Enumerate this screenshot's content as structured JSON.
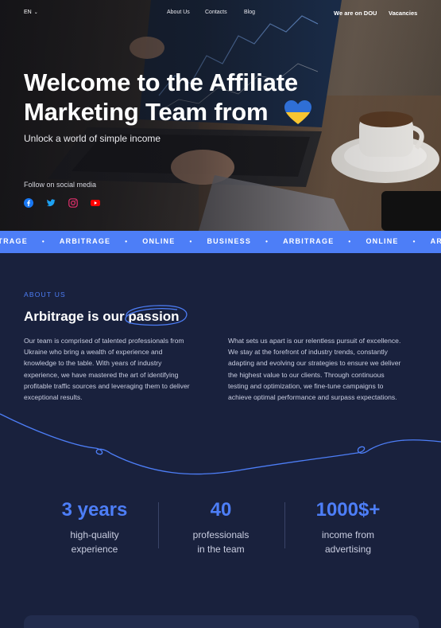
{
  "nav": {
    "lang": "EN",
    "links": [
      "About Us",
      "Contacts",
      "Blog"
    ],
    "dou": "We are on DOU",
    "vacancies": "Vacancies"
  },
  "hero": {
    "title_line1": "Welcome to the Affiliate",
    "title_line2": "Marketing Team from",
    "subtitle": "Unlock a world of simple income",
    "follow": "Follow on social media",
    "socials": [
      "facebook-icon",
      "twitter-icon",
      "instagram-icon",
      "youtube-icon"
    ],
    "flag_colors": {
      "top": "#2f6fd6",
      "bottom": "#f7c531"
    }
  },
  "ticker": {
    "items": [
      "BITRAGE",
      "ARBITRAGE",
      "ONLINE",
      "BUSINESS",
      "ARBITRAGE",
      "ONLINE",
      "ARBITR"
    ],
    "color": "#4d7ef7"
  },
  "about": {
    "eyebrow": "ABOUT US",
    "title_prefix": "Arbitrage is our",
    "title_highlight": "passion",
    "left_text": "Our team is comprised of talented professionals from Ukraine who bring a wealth of experience and knowledge to the table. With years of industry experience, we have mastered the art of identifying profitable traffic sources and leveraging them to deliver exceptional results.",
    "right_text": "What sets us apart is our relentless pursuit of excellence. We stay at the forefront of industry trends, constantly adapting and evolving our strategies to ensure we deliver the highest value to our clients. Through continuous testing and optimization, we fine-tune campaigns to achieve optimal performance and surpass expectations."
  },
  "stats": [
    {
      "num": "3 years",
      "line1": "high-quality",
      "line2": "experience"
    },
    {
      "num": "40",
      "line1": "professionals",
      "line2": "in the team"
    },
    {
      "num": "1000$+",
      "line1": "income from",
      "line2": "advertising"
    }
  ],
  "colors": {
    "accent": "#4d7ef7",
    "background": "#19213d"
  }
}
